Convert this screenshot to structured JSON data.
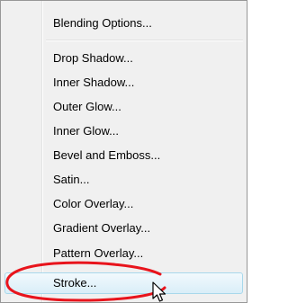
{
  "menu": {
    "items": [
      {
        "label": "Blending Options..."
      },
      {
        "label": "Drop Shadow..."
      },
      {
        "label": "Inner Shadow..."
      },
      {
        "label": "Outer Glow..."
      },
      {
        "label": "Inner Glow..."
      },
      {
        "label": "Bevel and Emboss..."
      },
      {
        "label": "Satin..."
      },
      {
        "label": "Color Overlay..."
      },
      {
        "label": "Gradient Overlay..."
      },
      {
        "label": "Pattern Overlay..."
      },
      {
        "label": "Stroke..."
      }
    ],
    "highlighted_item": "Stroke..."
  },
  "colors": {
    "menu_background": "#f0f0f0",
    "highlight_border": "#a8d8eb",
    "callout": "#e8141c"
  },
  "icons": [
    "mouse-pointer-icon"
  ]
}
